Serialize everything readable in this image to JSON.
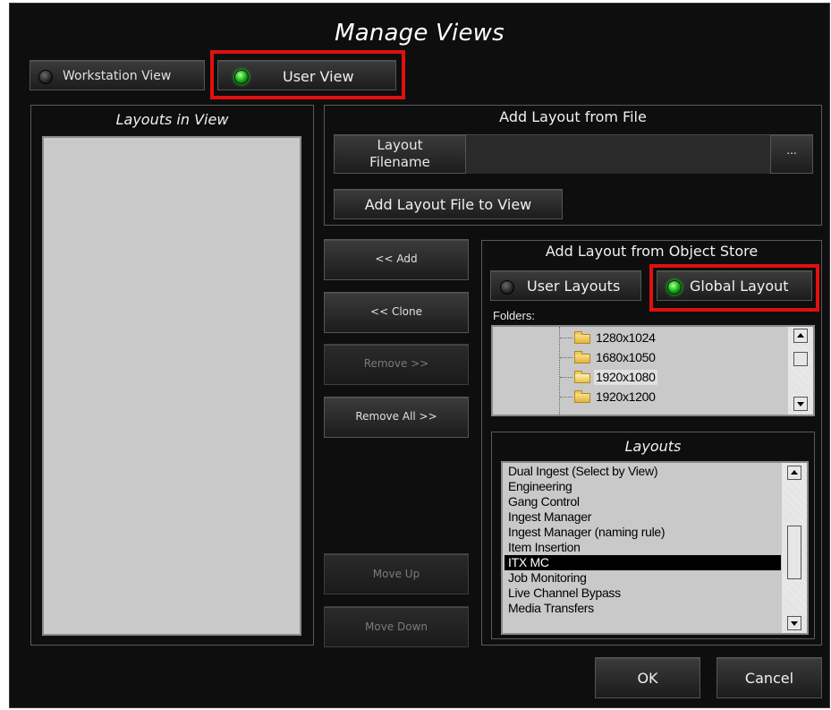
{
  "window": {
    "title": "Manage Views"
  },
  "view_toggle": {
    "workstation_label": "Workstation View",
    "user_label": "User View"
  },
  "layouts_in_view": {
    "title": "Layouts in View"
  },
  "add_from_file": {
    "title": "Add Layout from File",
    "filename_label_line1": "Layout",
    "filename_label_line2": "Filename",
    "filename_value": "",
    "browse_label": "...",
    "add_button_label": "Add Layout File to View"
  },
  "middle_buttons": {
    "add": "<< Add",
    "clone": "<< Clone",
    "remove": "Remove >>",
    "remove_all": "Remove All >>",
    "move_up": "Move Up",
    "move_down": "Move Down"
  },
  "object_store": {
    "title": "Add Layout from Object Store",
    "user_layouts_label": "User Layouts",
    "global_layout_label": "Global Layout",
    "folders_label": "Folders:",
    "folders": [
      "1280x1024",
      "1680x1050",
      "1920x1080",
      "1920x1200"
    ],
    "selected_folder": "1920x1080",
    "layouts_title": "Layouts",
    "layouts": [
      "Dual Ingest (Select by View)",
      "Engineering",
      "Gang Control",
      "Ingest Manager",
      "Ingest Manager (naming rule)",
      "Item Insertion",
      "ITX MC",
      "Job Monitoring",
      "Live Channel Bypass",
      "Media Transfers"
    ],
    "selected_layout": "ITX MC"
  },
  "footer": {
    "ok": "OK",
    "cancel": "Cancel"
  },
  "colors": {
    "background": "#0e0e0e",
    "highlight_box": "#e01010",
    "led_on": "#1fbf1f"
  }
}
